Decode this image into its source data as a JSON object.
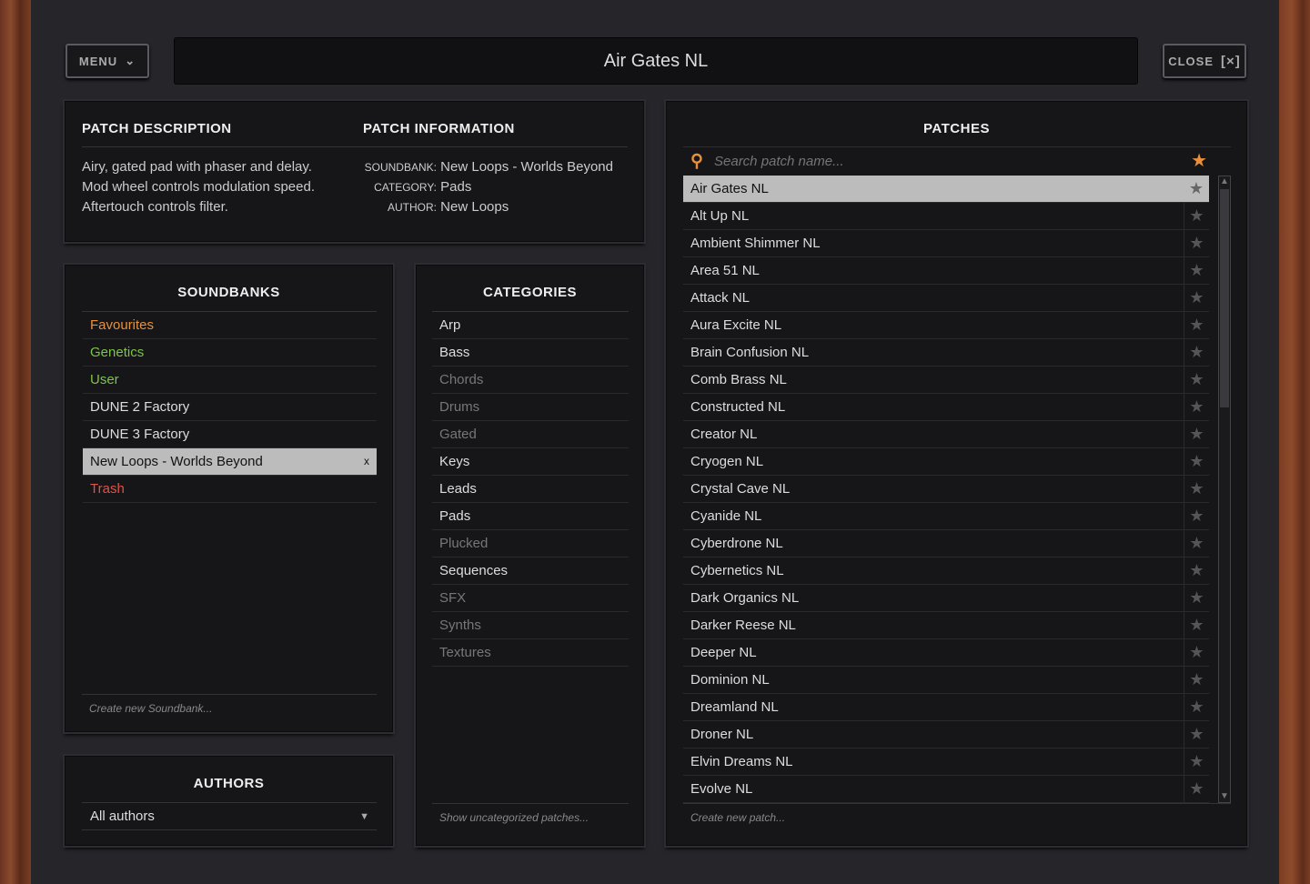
{
  "header": {
    "menu_label": "MENU",
    "title": "Air Gates NL",
    "close_label": "CLOSE"
  },
  "description": {
    "heading": "PATCH DESCRIPTION",
    "lines": [
      "Airy, gated pad with phaser and delay.",
      "Mod wheel controls modulation speed.",
      "Aftertouch controls filter."
    ]
  },
  "information": {
    "heading": "PATCH INFORMATION",
    "soundbank_label": "SOUNDBANK:",
    "soundbank": "New Loops - Worlds Beyond",
    "category_label": "CATEGORY:",
    "category": "Pads",
    "author_label": "AUTHOR:",
    "author": "New Loops"
  },
  "soundbanks": {
    "heading": "SOUNDBANKS",
    "items": [
      {
        "label": "Favourites",
        "color": "#e8913a"
      },
      {
        "label": "Genetics",
        "color": "#7cc44a"
      },
      {
        "label": "User",
        "color": "#7cc44a"
      },
      {
        "label": "DUNE 2 Factory",
        "color": "#dddddd"
      },
      {
        "label": "DUNE 3 Factory",
        "color": "#dddddd"
      },
      {
        "label": "New Loops - Worlds Beyond",
        "color": "#111111",
        "selected": true,
        "remove": "x"
      },
      {
        "label": "Trash",
        "color": "#e0524a"
      }
    ],
    "create": "Create new Soundbank..."
  },
  "authors": {
    "heading": "AUTHORS",
    "selected": "All authors"
  },
  "categories": {
    "heading": "CATEGORIES",
    "items": [
      {
        "label": "Arp",
        "enabled": true
      },
      {
        "label": "Bass",
        "enabled": true
      },
      {
        "label": "Chords",
        "enabled": false
      },
      {
        "label": "Drums",
        "enabled": false
      },
      {
        "label": "Gated",
        "enabled": false
      },
      {
        "label": "Keys",
        "enabled": true
      },
      {
        "label": "Leads",
        "enabled": true
      },
      {
        "label": "Pads",
        "enabled": true
      },
      {
        "label": "Plucked",
        "enabled": false
      },
      {
        "label": "Sequences",
        "enabled": true
      },
      {
        "label": "SFX",
        "enabled": false
      },
      {
        "label": "Synths",
        "enabled": false
      },
      {
        "label": "Textures",
        "enabled": false
      }
    ],
    "show_uncategorized": "Show uncategorized patches..."
  },
  "patches": {
    "heading": "PATCHES",
    "search_placeholder": "Search patch name...",
    "accent": "#e8913a",
    "selected": "Air Gates NL",
    "items": [
      "Air Gates NL",
      "Alt Up NL",
      "Ambient Shimmer NL",
      "Area 51 NL",
      "Attack NL",
      "Aura Excite NL",
      "Brain Confusion NL",
      "Comb Brass NL",
      "Constructed NL",
      "Creator NL",
      "Cryogen NL",
      "Crystal Cave NL",
      "Cyanide NL",
      "Cyberdrone NL",
      "Cybernetics NL",
      "Dark Organics NL",
      "Darker Reese NL",
      "Deeper NL",
      "Dominion NL",
      "Dreamland NL",
      "Droner NL",
      "Elvin Dreams NL",
      "Evolve NL"
    ],
    "create": "Create new patch..."
  }
}
